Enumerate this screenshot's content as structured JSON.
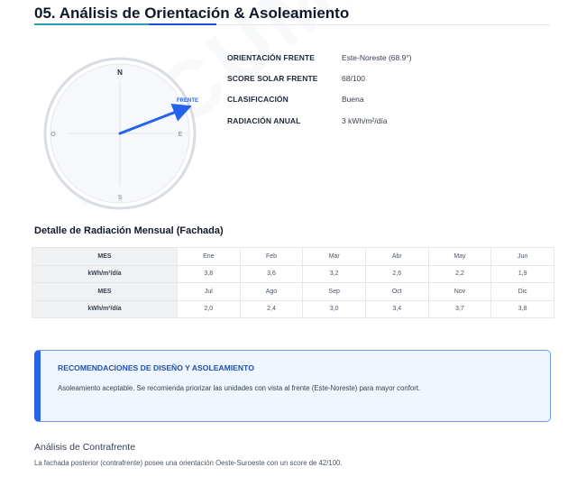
{
  "header": {
    "title": "05. Análisis de Orientación & Asoleamiento"
  },
  "compass": {
    "north": "N",
    "south": "S",
    "east": "E",
    "west": "O",
    "arrow_label": "FRENTE",
    "arrow_bearing_deg": 68.9,
    "arrow_color": "#2563eb"
  },
  "summary": {
    "rows": [
      {
        "label": "ORIENTACIÓN FRENTE",
        "value": "Este-Noreste (68.9°)"
      },
      {
        "label": "SCORE SOLAR FRENTE",
        "value": "68/100"
      },
      {
        "label": "CLASIFICACIÓN",
        "value": "Buena"
      },
      {
        "label": "RADIACIÓN ANUAL",
        "value": "3 kWh/m²/día"
      }
    ]
  },
  "monthly": {
    "title": "Detalle de Radiación Mensual (Fachada)",
    "row_header_month": "MES",
    "row_header_value": "kWh/m²/día",
    "months_1": [
      "Ene",
      "Feb",
      "Mar",
      "Abr",
      "May",
      "Jun"
    ],
    "values_1": [
      "3,8",
      "3,6",
      "3,2",
      "2,6",
      "2,2",
      "1,9"
    ],
    "months_2": [
      "Jul",
      "Ago",
      "Sep",
      "Oct",
      "Nov",
      "Dic"
    ],
    "values_2": [
      "2,0",
      "2,4",
      "3,0",
      "3,4",
      "3,7",
      "3,8"
    ]
  },
  "recommendation": {
    "title": "RECOMENDACIONES DE DISEÑO Y ASOLEAMIENTO",
    "text": "Asoleamiento aceptable. Se recomienda priorizar las unidades con vista al frente (Este-Noreste) para mayor confort.",
    "accent_color": "#2563eb"
  },
  "contrafrente": {
    "title": "Análisis de Contrafrente",
    "text": "La fachada posterior (contrafrente) posee una orientación Oeste-Suroeste con un score de 42/100."
  }
}
